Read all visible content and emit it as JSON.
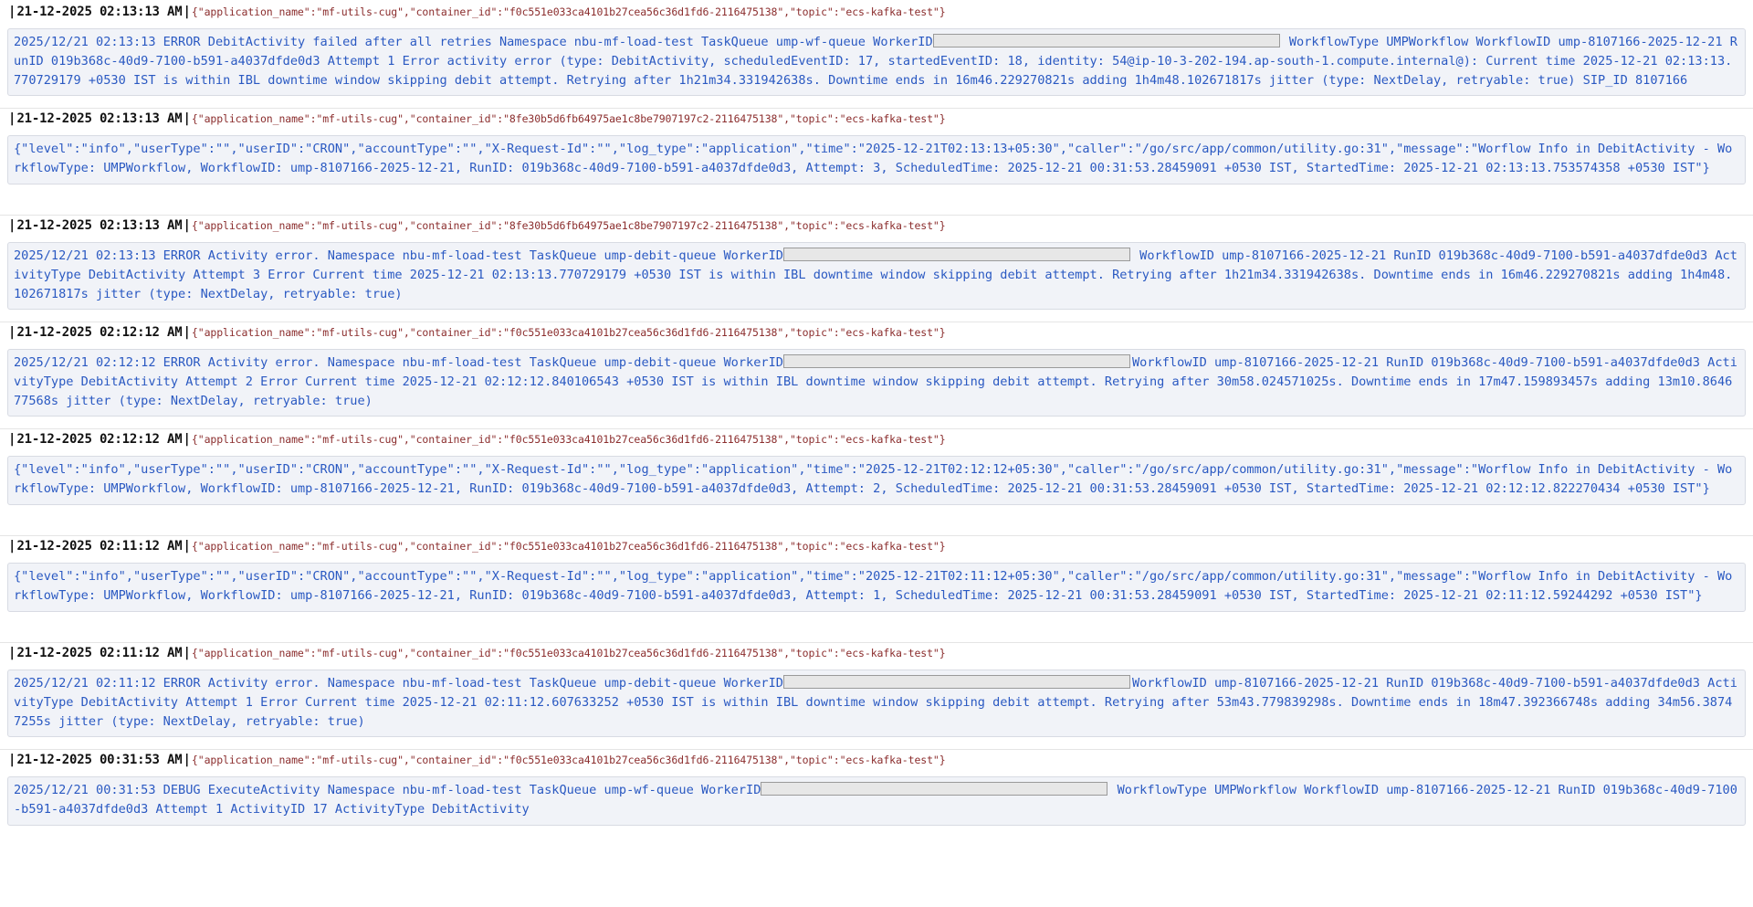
{
  "logs": [
    {
      "timestamp": "21-12-2025 02:13:13 AM",
      "meta": "{\"application_name\":\"mf-utils-cug\",\"container_id\":\"f0c551e033ca4101b27cea56c36d1fd6-2116475138\",\"topic\":\"ecs-kafka-test\"}",
      "msg_before": "2025/12/21 02:13:13 ERROR DebitActivity failed after all retries Namespace nbu-mf-load-test TaskQueue ump-wf-queue WorkerID",
      "msg_after": " WorkflowType UMPWorkflow WorkflowID ump-8107166-2025-12-21 RunID 019b368c-40d9-7100-b591-a4037dfde0d3 Attempt 1 Error activity error (type: DebitActivity, scheduledEventID: 17, startedEventID: 18, identity: 54@ip-10-3-202-194.ap-south-1.compute.internal@): Current time 2025-12-21 02:13:13.770729179 +0530 IST is within IBL downtime window skipping debit attempt. Retrying after 1h21m34.331942638s. Downtime ends in 16m46.229270821s adding 1h4m48.102671817s jitter (type: NextDelay, retryable: true) SIP_ID 8107166"
    },
    {
      "timestamp": "21-12-2025 02:13:13 AM",
      "meta": "{\"application_name\":\"mf-utils-cug\",\"container_id\":\"8fe30b5d6fb64975ae1c8be7907197c2-2116475138\",\"topic\":\"ecs-kafka-test\"}",
      "msg_before": "{\"level\":\"info\",\"userType\":\"\",\"userID\":\"CRON\",\"accountType\":\"\",\"X-Request-Id\":\"\",\"log_type\":\"application\",\"time\":\"2025-12-21T02:13:13+05:30\",\"caller\":\"/go/src/app/common/utility.go:31\",\"message\":\"Worflow Info in DebitActivity - WorkflowType: UMPWorkflow, WorkflowID: ump-8107166-2025-12-21, RunID: 019b368c-40d9-7100-b591-a4037dfde0d3, Attempt: 3, ScheduledTime: 2025-12-21 00:31:53.28459091 +0530 IST, StartedTime: 2025-12-21 02:13:13.753574358 +0530 IST\"}",
      "msg_after": ""
    },
    {
      "timestamp": "21-12-2025 02:13:13 AM",
      "meta": "{\"application_name\":\"mf-utils-cug\",\"container_id\":\"8fe30b5d6fb64975ae1c8be7907197c2-2116475138\",\"topic\":\"ecs-kafka-test\"}",
      "msg_before": "2025/12/21 02:13:13 ERROR Activity error. Namespace nbu-mf-load-test TaskQueue ump-debit-queue WorkerID",
      "msg_after": " WorkflowID ump-8107166-2025-12-21 RunID 019b368c-40d9-7100-b591-a4037dfde0d3 ActivityType DebitActivity Attempt 3 Error Current time 2025-12-21 02:13:13.770729179 +0530 IST is within IBL downtime window skipping debit attempt. Retrying after 1h21m34.331942638s. Downtime ends in 16m46.229270821s adding 1h4m48.102671817s jitter (type: NextDelay, retryable: true)"
    },
    {
      "timestamp": "21-12-2025 02:12:12 AM",
      "meta": "{\"application_name\":\"mf-utils-cug\",\"container_id\":\"f0c551e033ca4101b27cea56c36d1fd6-2116475138\",\"topic\":\"ecs-kafka-test\"}",
      "msg_before": "2025/12/21 02:12:12 ERROR Activity error. Namespace nbu-mf-load-test TaskQueue ump-debit-queue WorkerID",
      "msg_after": "WorkflowID ump-8107166-2025-12-21 RunID 019b368c-40d9-7100-b591-a4037dfde0d3 ActivityType DebitActivity Attempt 2 Error Current time 2025-12-21 02:12:12.840106543 +0530 IST is within IBL downtime window skipping debit attempt. Retrying after 30m58.024571025s. Downtime ends in 17m47.159893457s adding 13m10.864677568s jitter (type: NextDelay, retryable: true)"
    },
    {
      "timestamp": "21-12-2025 02:12:12 AM",
      "meta": "{\"application_name\":\"mf-utils-cug\",\"container_id\":\"f0c551e033ca4101b27cea56c36d1fd6-2116475138\",\"topic\":\"ecs-kafka-test\"}",
      "msg_before": "{\"level\":\"info\",\"userType\":\"\",\"userID\":\"CRON\",\"accountType\":\"\",\"X-Request-Id\":\"\",\"log_type\":\"application\",\"time\":\"2025-12-21T02:12:12+05:30\",\"caller\":\"/go/src/app/common/utility.go:31\",\"message\":\"Worflow Info in DebitActivity - WorkflowType: UMPWorkflow, WorkflowID: ump-8107166-2025-12-21, RunID: 019b368c-40d9-7100-b591-a4037dfde0d3, Attempt: 2, ScheduledTime: 2025-12-21 00:31:53.28459091 +0530 IST, StartedTime: 2025-12-21 02:12:12.822270434 +0530 IST\"}",
      "msg_after": ""
    },
    {
      "timestamp": "21-12-2025 02:11:12 AM",
      "meta": "{\"application_name\":\"mf-utils-cug\",\"container_id\":\"f0c551e033ca4101b27cea56c36d1fd6-2116475138\",\"topic\":\"ecs-kafka-test\"}",
      "msg_before": "{\"level\":\"info\",\"userType\":\"\",\"userID\":\"CRON\",\"accountType\":\"\",\"X-Request-Id\":\"\",\"log_type\":\"application\",\"time\":\"2025-12-21T02:11:12+05:30\",\"caller\":\"/go/src/app/common/utility.go:31\",\"message\":\"Worflow Info in DebitActivity - WorkflowType: UMPWorkflow, WorkflowID: ump-8107166-2025-12-21, RunID: 019b368c-40d9-7100-b591-a4037dfde0d3, Attempt: 1, ScheduledTime: 2025-12-21 00:31:53.28459091 +0530 IST, StartedTime: 2025-12-21 02:11:12.59244292 +0530 IST\"}",
      "msg_after": ""
    },
    {
      "timestamp": "21-12-2025 02:11:12 AM",
      "meta": "{\"application_name\":\"mf-utils-cug\",\"container_id\":\"f0c551e033ca4101b27cea56c36d1fd6-2116475138\",\"topic\":\"ecs-kafka-test\"}",
      "msg_before": "2025/12/21 02:11:12 ERROR Activity error. Namespace nbu-mf-load-test TaskQueue ump-debit-queue WorkerID",
      "msg_after": "WorkflowID ump-8107166-2025-12-21 RunID 019b368c-40d9-7100-b591-a4037dfde0d3 ActivityType DebitActivity Attempt 1 Error Current time 2025-12-21 02:11:12.607633252 +0530 IST is within IBL downtime window skipping debit attempt. Retrying after 53m43.779839298s. Downtime ends in 18m47.392366748s adding 34m56.38747255s jitter (type: NextDelay, retryable: true)"
    },
    {
      "timestamp": "21-12-2025 00:31:53 AM",
      "meta": "{\"application_name\":\"mf-utils-cug\",\"container_id\":\"f0c551e033ca4101b27cea56c36d1fd6-2116475138\",\"topic\":\"ecs-kafka-test\"}",
      "msg_before": "2025/12/21 00:31:53 DEBUG ExecuteActivity Namespace nbu-mf-load-test TaskQueue ump-wf-queue WorkerID",
      "msg_after": " WorkflowType UMPWorkflow WorkflowID ump-8107166-2025-12-21 RunID 019b368c-40d9-7100-b591-a4037dfde0d3 Attempt 1 ActivityID 17 ActivityType DebitActivity"
    }
  ]
}
